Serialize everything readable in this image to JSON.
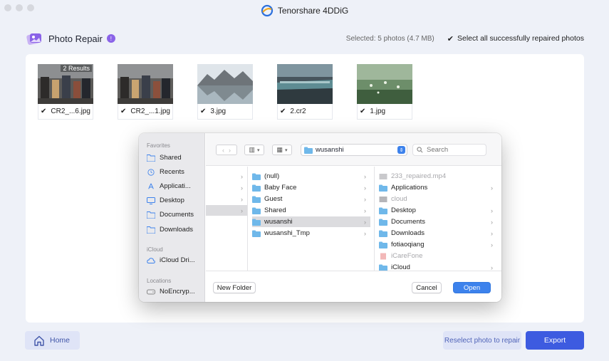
{
  "app": {
    "title": "Tenorshare 4DDiG"
  },
  "header": {
    "title": "Photo Repair",
    "badge": "!",
    "selected_info": "Selected: 5 photos  (4.7 MB)",
    "select_all_label": "Select all successfully repaired photos"
  },
  "photos": [
    {
      "name": "CR2_...6.jpg",
      "tag": "2 Results"
    },
    {
      "name": "CR2_...1.jpg"
    },
    {
      "name": "3.jpg"
    },
    {
      "name": "2.cr2"
    },
    {
      "name": "1.jpg"
    }
  ],
  "dialog": {
    "sidebar": {
      "favorites_label": "Favorites",
      "favorites": [
        "Shared",
        "Recents",
        "Applicati...",
        "Desktop",
        "Documents",
        "Downloads"
      ],
      "icloud_label": "iCloud",
      "icloud": [
        "iCloud Dri..."
      ],
      "locations_label": "Locations",
      "locations": [
        "NoEncryp..."
      ]
    },
    "toolbar": {
      "current_folder": "wusanshi",
      "search_placeholder": "Search"
    },
    "column2": [
      "(null)",
      "Baby Face",
      "Guest",
      "Shared",
      "wusanshi",
      "wusanshi_Tmp"
    ],
    "column3": [
      "233_repaired.mp4",
      "Applications",
      "cloud",
      "Desktop",
      "Documents",
      "Downloads",
      "fotiaoqiang",
      "iCareFone",
      "iCloud"
    ],
    "new_folder_label": "New Folder",
    "cancel_label": "Cancel",
    "open_label": "Open"
  },
  "bottom": {
    "home_label": "Home",
    "reselect_label": "Reselect photo to repair",
    "export_label": "Export"
  },
  "colors": {
    "accent": "#3d5be0",
    "mac_blue": "#3d82ec",
    "folder": "#6fb8ea",
    "badge": "#8a63e8"
  }
}
